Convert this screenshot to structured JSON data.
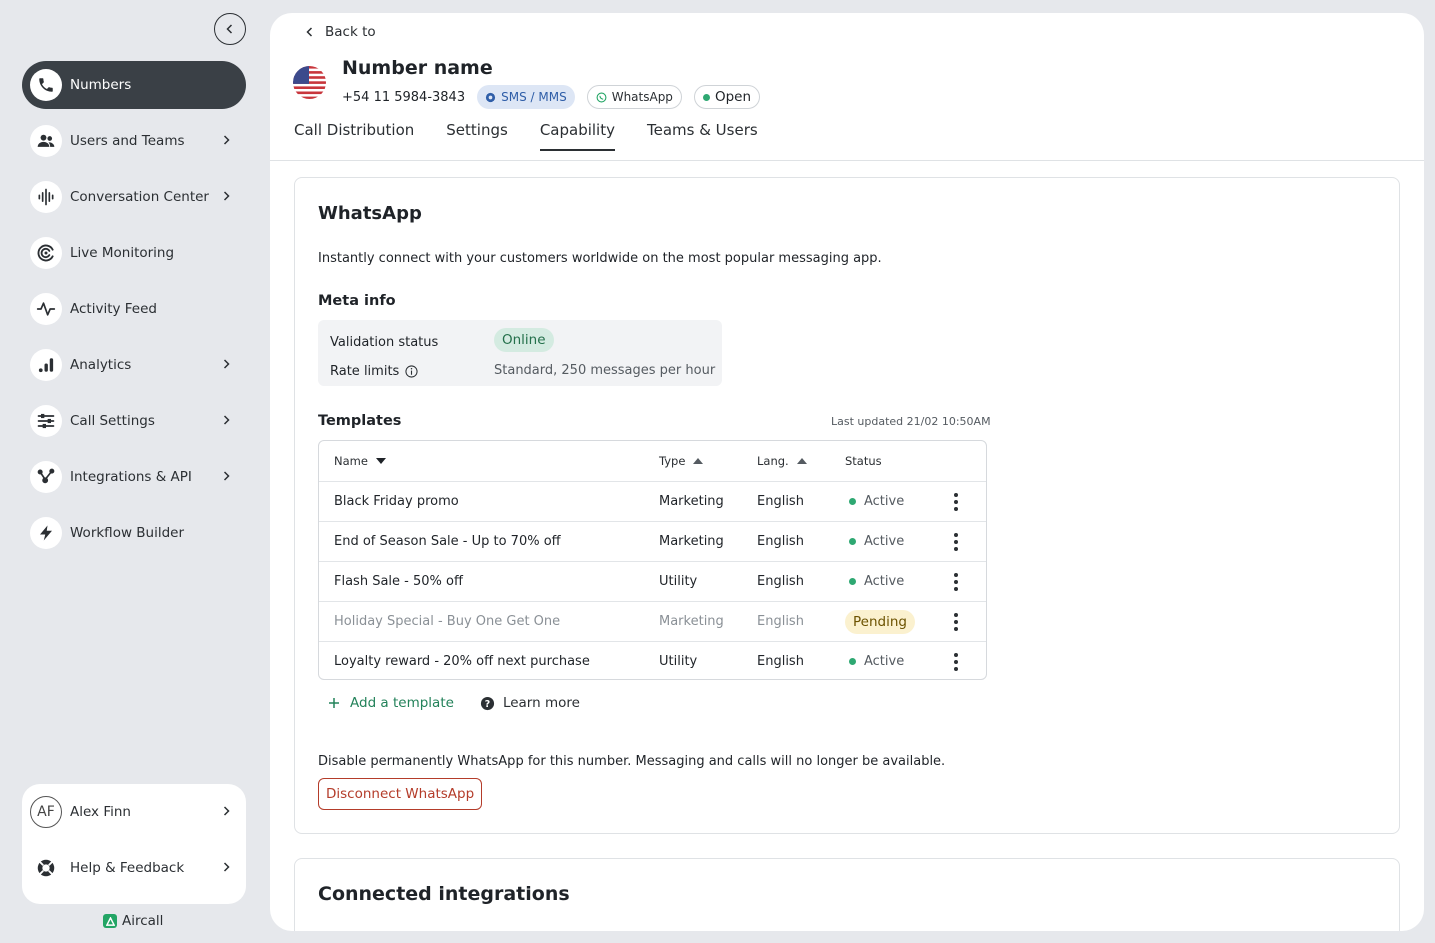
{
  "sidebar": {
    "items": [
      {
        "label": "Numbers",
        "icon": "phone-icon"
      },
      {
        "label": "Users and Teams",
        "icon": "users-icon"
      },
      {
        "label": "Conversation Center",
        "icon": "waveform-icon"
      },
      {
        "label": "Live Monitoring",
        "icon": "live-monitoring-icon"
      },
      {
        "label": "Activity Feed",
        "icon": "activity-icon"
      },
      {
        "label": "Analytics",
        "icon": "analytics-icon"
      },
      {
        "label": "Call Settings",
        "icon": "sliders-icon"
      },
      {
        "label": "Integrations & API",
        "icon": "integrations-icon"
      },
      {
        "label": "Workflow Builder",
        "icon": "lightning-icon"
      }
    ],
    "user": {
      "initials": "AF",
      "name": "Alex Finn"
    },
    "help_label": "Help & Feedback",
    "brand": "Aircall"
  },
  "header": {
    "back_label": "Back to",
    "title": "Number name",
    "phone": "+54 11 5984-3843",
    "badges": {
      "sms": "SMS / MMS",
      "whatsapp": "WhatsApp",
      "status": "Open"
    }
  },
  "tabs": [
    {
      "label": "Call Distribution"
    },
    {
      "label": "Settings"
    },
    {
      "label": "Capability"
    },
    {
      "label": "Teams & Users"
    }
  ],
  "whatsapp": {
    "title": "WhatsApp",
    "description": "Instantly connect with your customers worldwide on the most popular messaging app.",
    "meta_title": "Meta info",
    "validation_label": "Validation status",
    "validation_value": "Online",
    "rate_label": "Rate limits",
    "rate_value": "Standard, 250 messages per hour",
    "templates_title": "Templates",
    "last_updated": "Last updated 21/02 10:50AM",
    "table": {
      "headers": {
        "name": "Name",
        "type": "Type",
        "lang": "Lang.",
        "status": "Status"
      },
      "rows": [
        {
          "name": "Black Friday promo",
          "type": "Marketing",
          "lang": "English",
          "status": "Active"
        },
        {
          "name": "End of Season Sale - Up to 70% off",
          "type": "Marketing",
          "lang": "English",
          "status": "Active"
        },
        {
          "name": "Flash Sale - 50% off",
          "type": "Utility",
          "lang": "English",
          "status": "Active"
        },
        {
          "name": "Holiday Special - Buy One Get One",
          "type": "Marketing",
          "lang": "English",
          "status": "Pending"
        },
        {
          "name": "Loyalty reward - 20% off next purchase",
          "type": "Utility",
          "lang": "English",
          "status": "Active"
        }
      ]
    },
    "add_template_label": "Add a template",
    "learn_more_label": "Learn more",
    "disable_text": "Disable permanently WhatsApp for this number. Messaging and calls will no longer be available.",
    "disconnect_label": "Disconnect WhatsApp"
  },
  "integrations": {
    "title": "Connected integrations"
  },
  "colors": {
    "accent_green": "#23825a",
    "danger": "#b43c2a",
    "active_dot": "#2ea872",
    "sidebar_active": "#3a4046"
  }
}
